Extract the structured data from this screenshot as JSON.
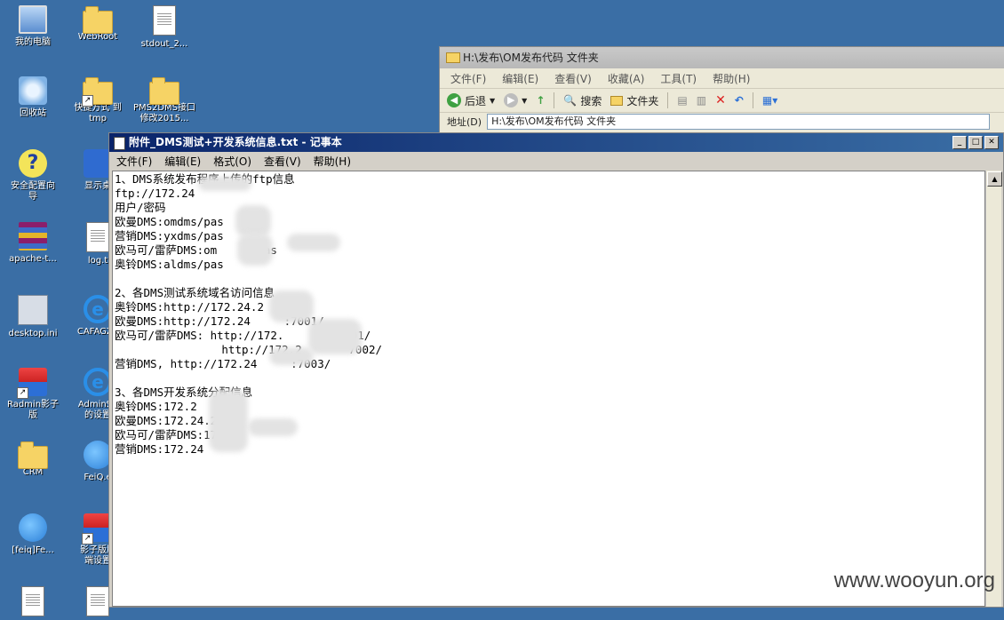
{
  "desktop": {
    "icons": [
      {
        "label": "我的电脑",
        "icon": "computer-icon"
      },
      {
        "label": "WebRoot",
        "icon": "folder-icon"
      },
      {
        "label": "stdout_2...",
        "icon": "document-icon"
      },
      {
        "label": "回收站",
        "icon": "recycle-bin-icon"
      },
      {
        "label": "快捷方式 到\ntmp",
        "icon": "folder-shortcut-icon"
      },
      {
        "label": "PMS2DMS接口\n修改2015...",
        "icon": "folder-icon"
      },
      {
        "label": "安全配置向\n导",
        "icon": "help-wizard-icon"
      },
      {
        "label": "显示桌",
        "icon": "show-desktop-icon"
      },
      {
        "label": "apache-t...",
        "icon": "winrar-icon"
      },
      {
        "label": "log.t",
        "icon": "document-icon"
      },
      {
        "label": "desktop.ini",
        "icon": "settings-file-icon"
      },
      {
        "label": "CAFAGZ3",
        "icon": "ie-icon"
      },
      {
        "label": "Radmin影子\n版",
        "icon": "radmin-icon"
      },
      {
        "label": "AdminSe\n的设置",
        "icon": "ie-icon"
      },
      {
        "label": "CRM",
        "icon": "folder-icon"
      },
      {
        "label": "FeiQ.e",
        "icon": "feiq-icon"
      },
      {
        "label": "[feiq]Fe...",
        "icon": "feiq-icon"
      },
      {
        "label": "影子版服\n端设置",
        "icon": "radmin-shortcut-icon"
      }
    ]
  },
  "explorer": {
    "title": "H:\\发布\\OM发布代码 文件夹",
    "menu": [
      "文件(F)",
      "编辑(E)",
      "查看(V)",
      "收藏(A)",
      "工具(T)",
      "帮助(H)"
    ],
    "toolbar": {
      "back": "后退",
      "search": "搜索",
      "folders": "文件夹"
    },
    "address_label": "地址(D)",
    "address_value": "H:\\发布\\OM发布代码 文件夹"
  },
  "notepad": {
    "title": "附件_DMS测试+开发系统信息.txt - 记事本",
    "menu": [
      "文件(F)",
      "编辑(E)",
      "格式(O)",
      "查看(V)",
      "帮助(H)"
    ],
    "content": "1、DMS系统发布程序上传的ftp信息\nftp://172.24\n用户/密码\n欧曼DMS:omdms/pas    2\n营销DMS:yxdms/pas\n欧马可/雷萨DMS:om     /pas\n奥铃DMS:aldms/pas\n\n2、各DMS测试系统域名访问信息\n奥铃DMS:http://172.24.2\n欧曼DMS:http://172.24     :7001/\n欧马可/雷萨DMS: http://172.       :7001/\n                http://172.2       7002/\n营销DMS, http://172.24     :7003/\n\n3、各DMS开发系统分配信息\n奥铃DMS:172.2    2\n欧曼DMS:172.24.2\n欧马可/雷萨DMS:172.2\n营销DMS:172.24"
  },
  "watermark": "www.wooyun.org"
}
